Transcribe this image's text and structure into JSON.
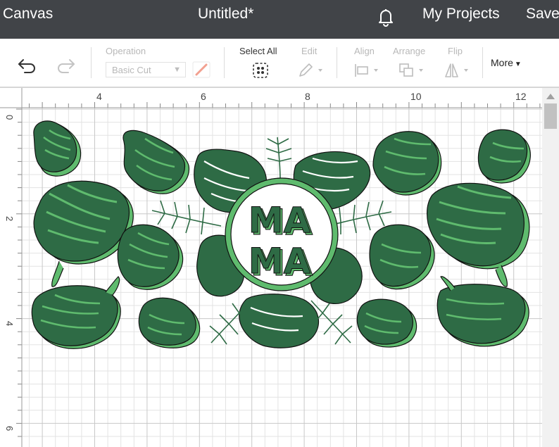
{
  "header": {
    "canvas_label": "Canvas",
    "document_title": "Untitled*",
    "my_projects_label": "My Projects",
    "save_label": "Save",
    "notifications_icon": "bell-icon",
    "background_color": "#414448"
  },
  "toolbar": {
    "undo_icon": "undo-icon",
    "redo_icon": "redo-icon",
    "operation_label": "Operation",
    "operation_value": "Basic Cut",
    "select_all_label": "Select All",
    "edit_label": "Edit",
    "align_label": "Align",
    "arrange_label": "Arrange",
    "flip_label": "Flip",
    "more_label": "More"
  },
  "canvas": {
    "ruler_top_labels": [
      "4",
      "6",
      "8",
      "10",
      "12"
    ],
    "ruler_left_labels": [
      "0",
      "2",
      "4",
      "6"
    ],
    "design": {
      "monogram_top": "MA",
      "monogram_bottom": "MA",
      "dark_green": "#2e6b45",
      "light_green": "#5fbb6e"
    }
  }
}
